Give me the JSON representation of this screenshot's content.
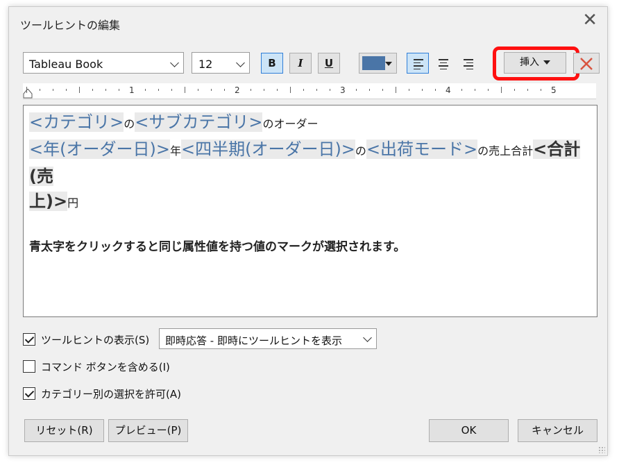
{
  "dialog": {
    "title": "ツールヒントの編集",
    "close_glyph": "✕"
  },
  "toolbar": {
    "font_value": "Tableau Book",
    "size_value": "12",
    "bold_label": "B",
    "italic_label": "I",
    "underline_label": "U",
    "text_color": "#4a75a7",
    "insert_label": "挿入",
    "icons": [
      "chevron-down-icon",
      "align-left-icon",
      "align-center-icon",
      "align-right-icon",
      "dropdown-caret-icon",
      "delete-x-icon"
    ]
  },
  "ruler": {
    "numbers": [
      "1",
      "2",
      "3",
      "4",
      "5"
    ]
  },
  "editor": {
    "field_category": "<カテゴリ>",
    "text_no1": "の",
    "field_subcategory": "<サブカテゴリ>",
    "text_order": "のオーダー",
    "field_year": "<年(オーダー日)>",
    "text_nen": "年",
    "field_quarter": "<四半期(オーダー日)>",
    "text_no2": "の",
    "field_shipmode": "<出荷モード>",
    "text_sales_total": "の売上合計",
    "field_sum_part1": "<合計(売",
    "field_sum_part2": "上)>",
    "text_yen": "円",
    "note": "青太字をクリックすると同じ属性値を持つ値のマークが選択されます。"
  },
  "options": {
    "show_tooltip_label": "ツールヒントの表示(S)",
    "show_tooltip_checked": true,
    "display_mode_value": "即時応答 - 即時にツールヒントを表示",
    "command_buttons_label": "コマンド ボタンを含める(I)",
    "command_buttons_checked": false,
    "allow_category_select_label": "カテゴリー別の選択を許可(A)",
    "allow_category_select_checked": true
  },
  "buttons": {
    "reset_label": "リセット(R)",
    "preview_label": "プレビュー(P)",
    "ok_label": "OK",
    "cancel_label": "キャンセル"
  },
  "colors": {
    "field_blue": "#4a75a7",
    "highlight_red": "#ff1010",
    "active_blue": "#cce4f7"
  }
}
